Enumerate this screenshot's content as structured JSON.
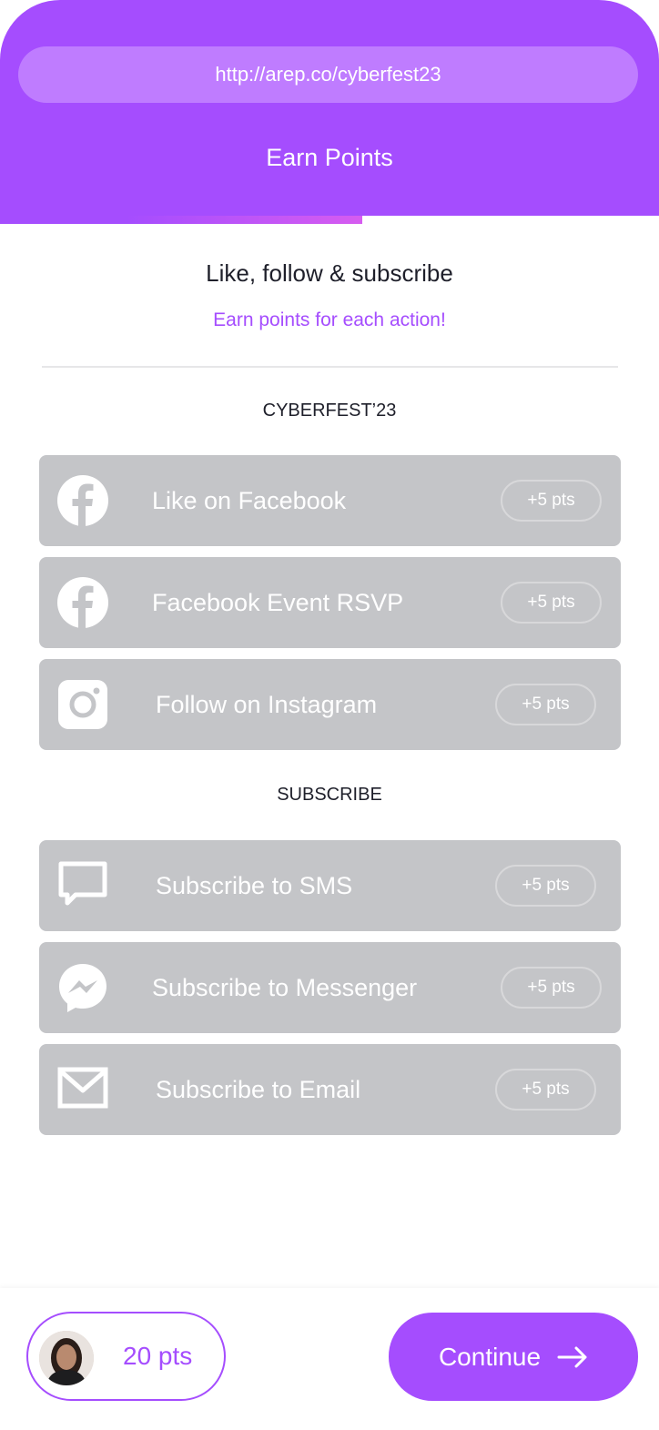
{
  "header": {
    "url": "http://arep.co/cyberfest23",
    "title": "Earn Points",
    "progress_fraction": 0.55
  },
  "intro": {
    "title": "Like, follow & subscribe",
    "subtitle": "Earn points for each action!"
  },
  "groups": [
    {
      "label": "CYBERFEST’23",
      "actions": [
        {
          "label": "Like on Facebook",
          "points": "+5 pts",
          "icon": "facebook-icon"
        },
        {
          "label": "Facebook Event RSVP",
          "points": "+5 pts",
          "icon": "facebook-icon"
        },
        {
          "label": "Follow on Instagram",
          "points": "+5 pts",
          "icon": "instagram-icon"
        }
      ]
    },
    {
      "label": "SUBSCRIBE",
      "actions": [
        {
          "label": "Subscribe to SMS",
          "points": "+5 pts",
          "icon": "chat-bubble-icon"
        },
        {
          "label": "Subscribe to Messenger",
          "points": "+5 pts",
          "icon": "messenger-icon"
        },
        {
          "label": "Subscribe to Email",
          "points": "+5 pts",
          "icon": "envelope-icon"
        }
      ]
    }
  ],
  "footer": {
    "points": "20 pts",
    "continue_label": "Continue",
    "avatar_icon": "user-avatar"
  },
  "colors": {
    "accent": "#a54dfe",
    "url_bar": "#bf7cff",
    "action_bg": "#c4c5c8",
    "text_dark": "#1e1f2a"
  }
}
